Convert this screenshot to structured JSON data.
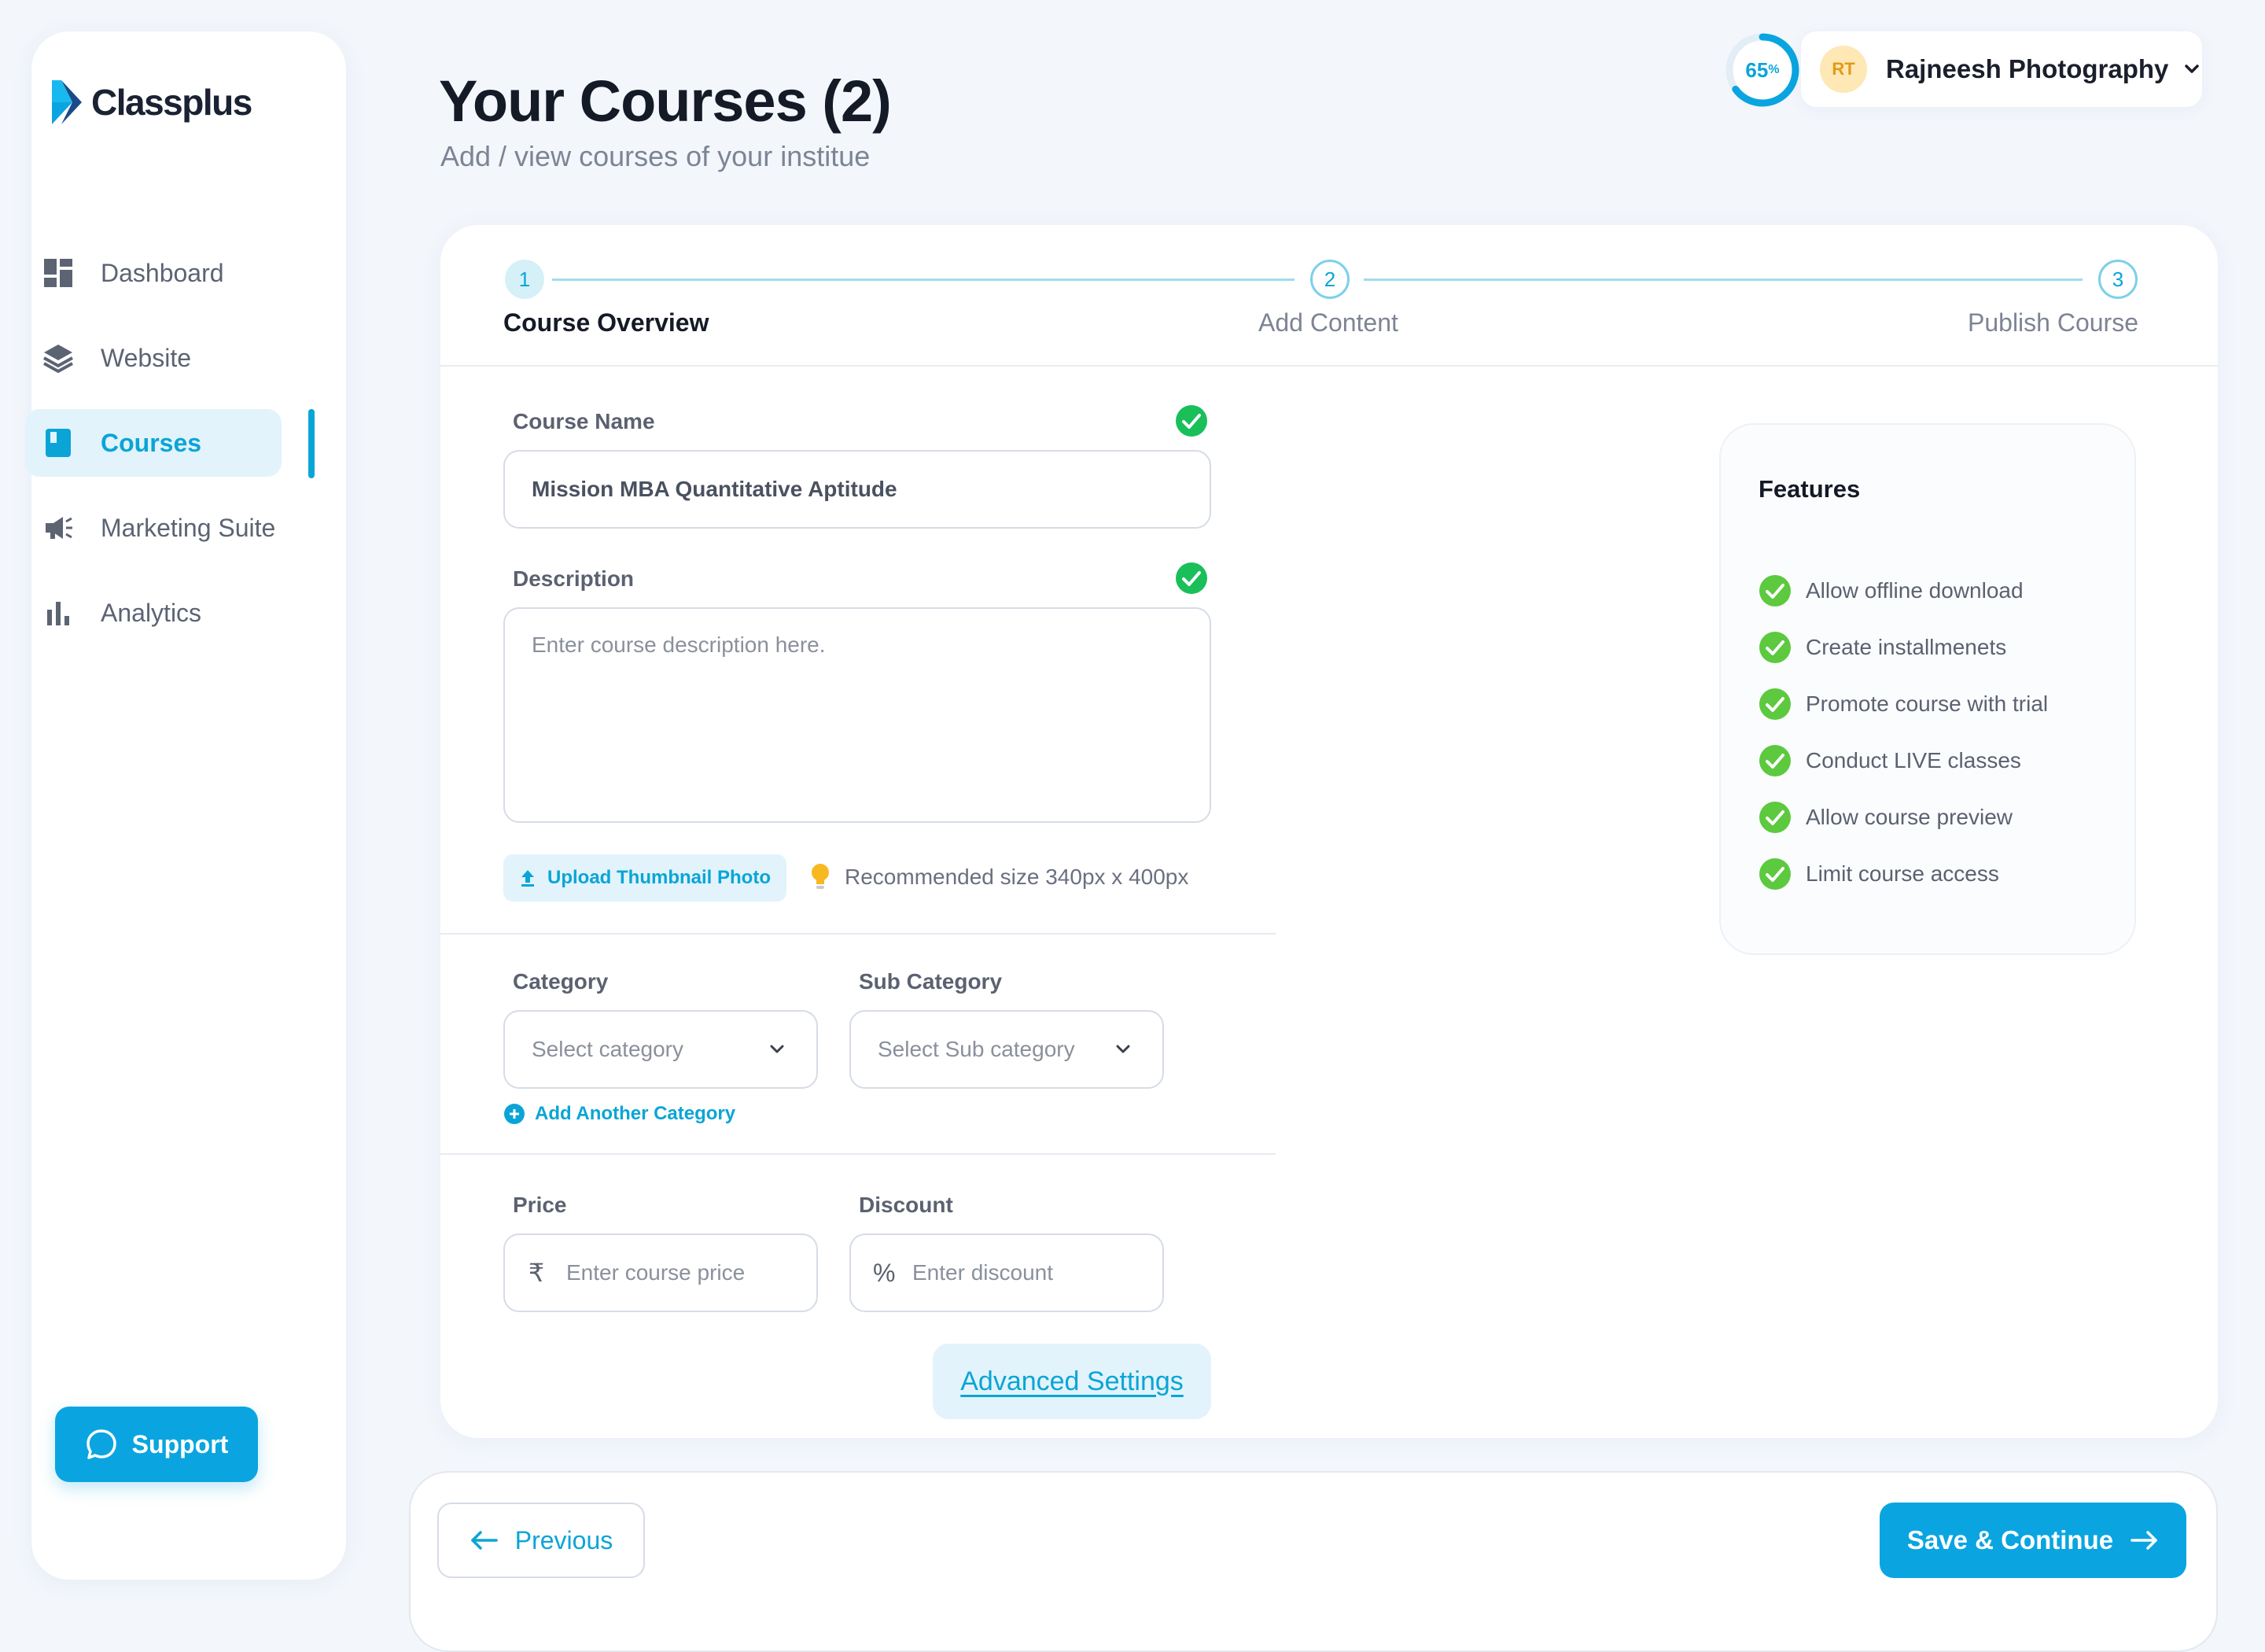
{
  "brand": {
    "name": "Classplus",
    "accent": "#0aa5e0"
  },
  "sidebar": {
    "items": [
      {
        "label": "Dashboard",
        "icon": "dashboard-icon",
        "active": false
      },
      {
        "label": "Website",
        "icon": "layers-icon",
        "active": false
      },
      {
        "label": "Courses",
        "icon": "book-icon",
        "active": true
      },
      {
        "label": "Marketing Suite",
        "icon": "megaphone-icon",
        "active": false
      },
      {
        "label": "Analytics",
        "icon": "bar-chart-icon",
        "active": false
      }
    ],
    "support_label": "Support"
  },
  "header": {
    "title": "Your Courses (2)",
    "subtitle": "Add / view courses of your institue",
    "profile_progress": {
      "value": 65,
      "display": "65",
      "unit": "%"
    },
    "account": {
      "initials": "RT",
      "name": "Rajneesh Photography"
    }
  },
  "stepper": {
    "steps": [
      {
        "number": "1",
        "label": "Course Overview",
        "state": "current"
      },
      {
        "number": "2",
        "label": "Add Content",
        "state": "upcoming"
      },
      {
        "number": "3",
        "label": "Publish Course",
        "state": "upcoming"
      }
    ]
  },
  "form": {
    "course_name": {
      "label": "Course Name",
      "value": "Mission MBA Quantitative Aptitude",
      "valid": true
    },
    "description": {
      "label": "Description",
      "placeholder": "Enter course description here.",
      "valid": true
    },
    "upload_thumbnail_label": "Upload Thumbnail Photo",
    "recommended_size": "Recommended size 340px x  400px",
    "category": {
      "label": "Category",
      "placeholder": "Select category"
    },
    "sub_category": {
      "label": "Sub Category",
      "placeholder": "Select Sub category"
    },
    "add_category_label": "Add Another Category",
    "price": {
      "label": "Price",
      "prefix": "₹",
      "placeholder": "Enter course price"
    },
    "discount": {
      "label": "Discount",
      "prefix": "%",
      "placeholder": "Enter discount"
    },
    "advanced_settings_label": "Advanced Settings"
  },
  "features": {
    "title": "Features",
    "items": [
      "Allow offline download",
      "Create installmenets",
      "Promote course with trial",
      "Conduct LIVE classes",
      "Allow course preview",
      "Limit course access"
    ]
  },
  "footer": {
    "previous_label": "Previous",
    "save_label": "Save & Continue"
  }
}
